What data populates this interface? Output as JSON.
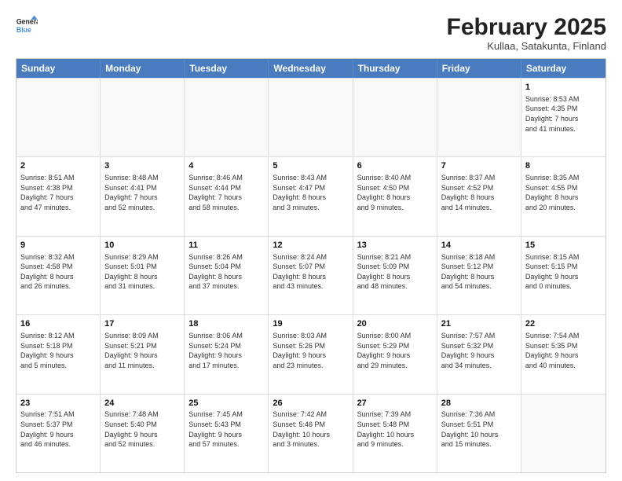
{
  "logo": {
    "line1": "General",
    "line2": "Blue"
  },
  "title": "February 2025",
  "subtitle": "Kullaa, Satakunta, Finland",
  "days": [
    "Sunday",
    "Monday",
    "Tuesday",
    "Wednesday",
    "Thursday",
    "Friday",
    "Saturday"
  ],
  "weeks": [
    [
      {
        "day": "",
        "info": ""
      },
      {
        "day": "",
        "info": ""
      },
      {
        "day": "",
        "info": ""
      },
      {
        "day": "",
        "info": ""
      },
      {
        "day": "",
        "info": ""
      },
      {
        "day": "",
        "info": ""
      },
      {
        "day": "1",
        "info": "Sunrise: 8:53 AM\nSunset: 4:35 PM\nDaylight: 7 hours\nand 41 minutes."
      }
    ],
    [
      {
        "day": "2",
        "info": "Sunrise: 8:51 AM\nSunset: 4:38 PM\nDaylight: 7 hours\nand 47 minutes."
      },
      {
        "day": "3",
        "info": "Sunrise: 8:48 AM\nSunset: 4:41 PM\nDaylight: 7 hours\nand 52 minutes."
      },
      {
        "day": "4",
        "info": "Sunrise: 8:46 AM\nSunset: 4:44 PM\nDaylight: 7 hours\nand 58 minutes."
      },
      {
        "day": "5",
        "info": "Sunrise: 8:43 AM\nSunset: 4:47 PM\nDaylight: 8 hours\nand 3 minutes."
      },
      {
        "day": "6",
        "info": "Sunrise: 8:40 AM\nSunset: 4:50 PM\nDaylight: 8 hours\nand 9 minutes."
      },
      {
        "day": "7",
        "info": "Sunrise: 8:37 AM\nSunset: 4:52 PM\nDaylight: 8 hours\nand 14 minutes."
      },
      {
        "day": "8",
        "info": "Sunrise: 8:35 AM\nSunset: 4:55 PM\nDaylight: 8 hours\nand 20 minutes."
      }
    ],
    [
      {
        "day": "9",
        "info": "Sunrise: 8:32 AM\nSunset: 4:58 PM\nDaylight: 8 hours\nand 26 minutes."
      },
      {
        "day": "10",
        "info": "Sunrise: 8:29 AM\nSunset: 5:01 PM\nDaylight: 8 hours\nand 31 minutes."
      },
      {
        "day": "11",
        "info": "Sunrise: 8:26 AM\nSunset: 5:04 PM\nDaylight: 8 hours\nand 37 minutes."
      },
      {
        "day": "12",
        "info": "Sunrise: 8:24 AM\nSunset: 5:07 PM\nDaylight: 8 hours\nand 43 minutes."
      },
      {
        "day": "13",
        "info": "Sunrise: 8:21 AM\nSunset: 5:09 PM\nDaylight: 8 hours\nand 48 minutes."
      },
      {
        "day": "14",
        "info": "Sunrise: 8:18 AM\nSunset: 5:12 PM\nDaylight: 8 hours\nand 54 minutes."
      },
      {
        "day": "15",
        "info": "Sunrise: 8:15 AM\nSunset: 5:15 PM\nDaylight: 9 hours\nand 0 minutes."
      }
    ],
    [
      {
        "day": "16",
        "info": "Sunrise: 8:12 AM\nSunset: 5:18 PM\nDaylight: 9 hours\nand 5 minutes."
      },
      {
        "day": "17",
        "info": "Sunrise: 8:09 AM\nSunset: 5:21 PM\nDaylight: 9 hours\nand 11 minutes."
      },
      {
        "day": "18",
        "info": "Sunrise: 8:06 AM\nSunset: 5:24 PM\nDaylight: 9 hours\nand 17 minutes."
      },
      {
        "day": "19",
        "info": "Sunrise: 8:03 AM\nSunset: 5:26 PM\nDaylight: 9 hours\nand 23 minutes."
      },
      {
        "day": "20",
        "info": "Sunrise: 8:00 AM\nSunset: 5:29 PM\nDaylight: 9 hours\nand 29 minutes."
      },
      {
        "day": "21",
        "info": "Sunrise: 7:57 AM\nSunset: 5:32 PM\nDaylight: 9 hours\nand 34 minutes."
      },
      {
        "day": "22",
        "info": "Sunrise: 7:54 AM\nSunset: 5:35 PM\nDaylight: 9 hours\nand 40 minutes."
      }
    ],
    [
      {
        "day": "23",
        "info": "Sunrise: 7:51 AM\nSunset: 5:37 PM\nDaylight: 9 hours\nand 46 minutes."
      },
      {
        "day": "24",
        "info": "Sunrise: 7:48 AM\nSunset: 5:40 PM\nDaylight: 9 hours\nand 52 minutes."
      },
      {
        "day": "25",
        "info": "Sunrise: 7:45 AM\nSunset: 5:43 PM\nDaylight: 9 hours\nand 57 minutes."
      },
      {
        "day": "26",
        "info": "Sunrise: 7:42 AM\nSunset: 5:46 PM\nDaylight: 10 hours\nand 3 minutes."
      },
      {
        "day": "27",
        "info": "Sunrise: 7:39 AM\nSunset: 5:48 PM\nDaylight: 10 hours\nand 9 minutes."
      },
      {
        "day": "28",
        "info": "Sunrise: 7:36 AM\nSunset: 5:51 PM\nDaylight: 10 hours\nand 15 minutes."
      },
      {
        "day": "",
        "info": ""
      }
    ]
  ]
}
